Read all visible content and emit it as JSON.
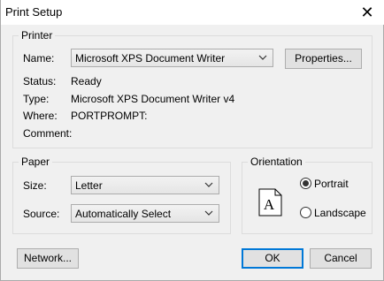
{
  "window": {
    "title": "Print Setup",
    "close_glyph": "✕"
  },
  "printer": {
    "legend": "Printer",
    "name_label": "Name:",
    "name_value": "Microsoft XPS Document Writer",
    "properties_button": "Properties...",
    "status_label": "Status:",
    "status_value": "Ready",
    "type_label": "Type:",
    "type_value": "Microsoft XPS Document Writer v4",
    "where_label": "Where:",
    "where_value": "PORTPROMPT:",
    "comment_label": "Comment:",
    "comment_value": ""
  },
  "paper": {
    "legend": "Paper",
    "size_label": "Size:",
    "size_value": "Letter",
    "source_label": "Source:",
    "source_value": "Automatically Select"
  },
  "orientation": {
    "legend": "Orientation",
    "page_glyph": "A",
    "portrait_label": "Portrait",
    "landscape_label": "Landscape",
    "selected": "Portrait"
  },
  "buttons": {
    "network": "Network...",
    "ok": "OK",
    "cancel": "Cancel"
  },
  "colors": {
    "accent": "#0078d7",
    "background": "#f0f0f0",
    "group_border": "#dcdcdc"
  },
  "icons": {
    "close": "close-icon",
    "dropdown": "chevron-down-icon",
    "page": "portrait-page-icon"
  }
}
